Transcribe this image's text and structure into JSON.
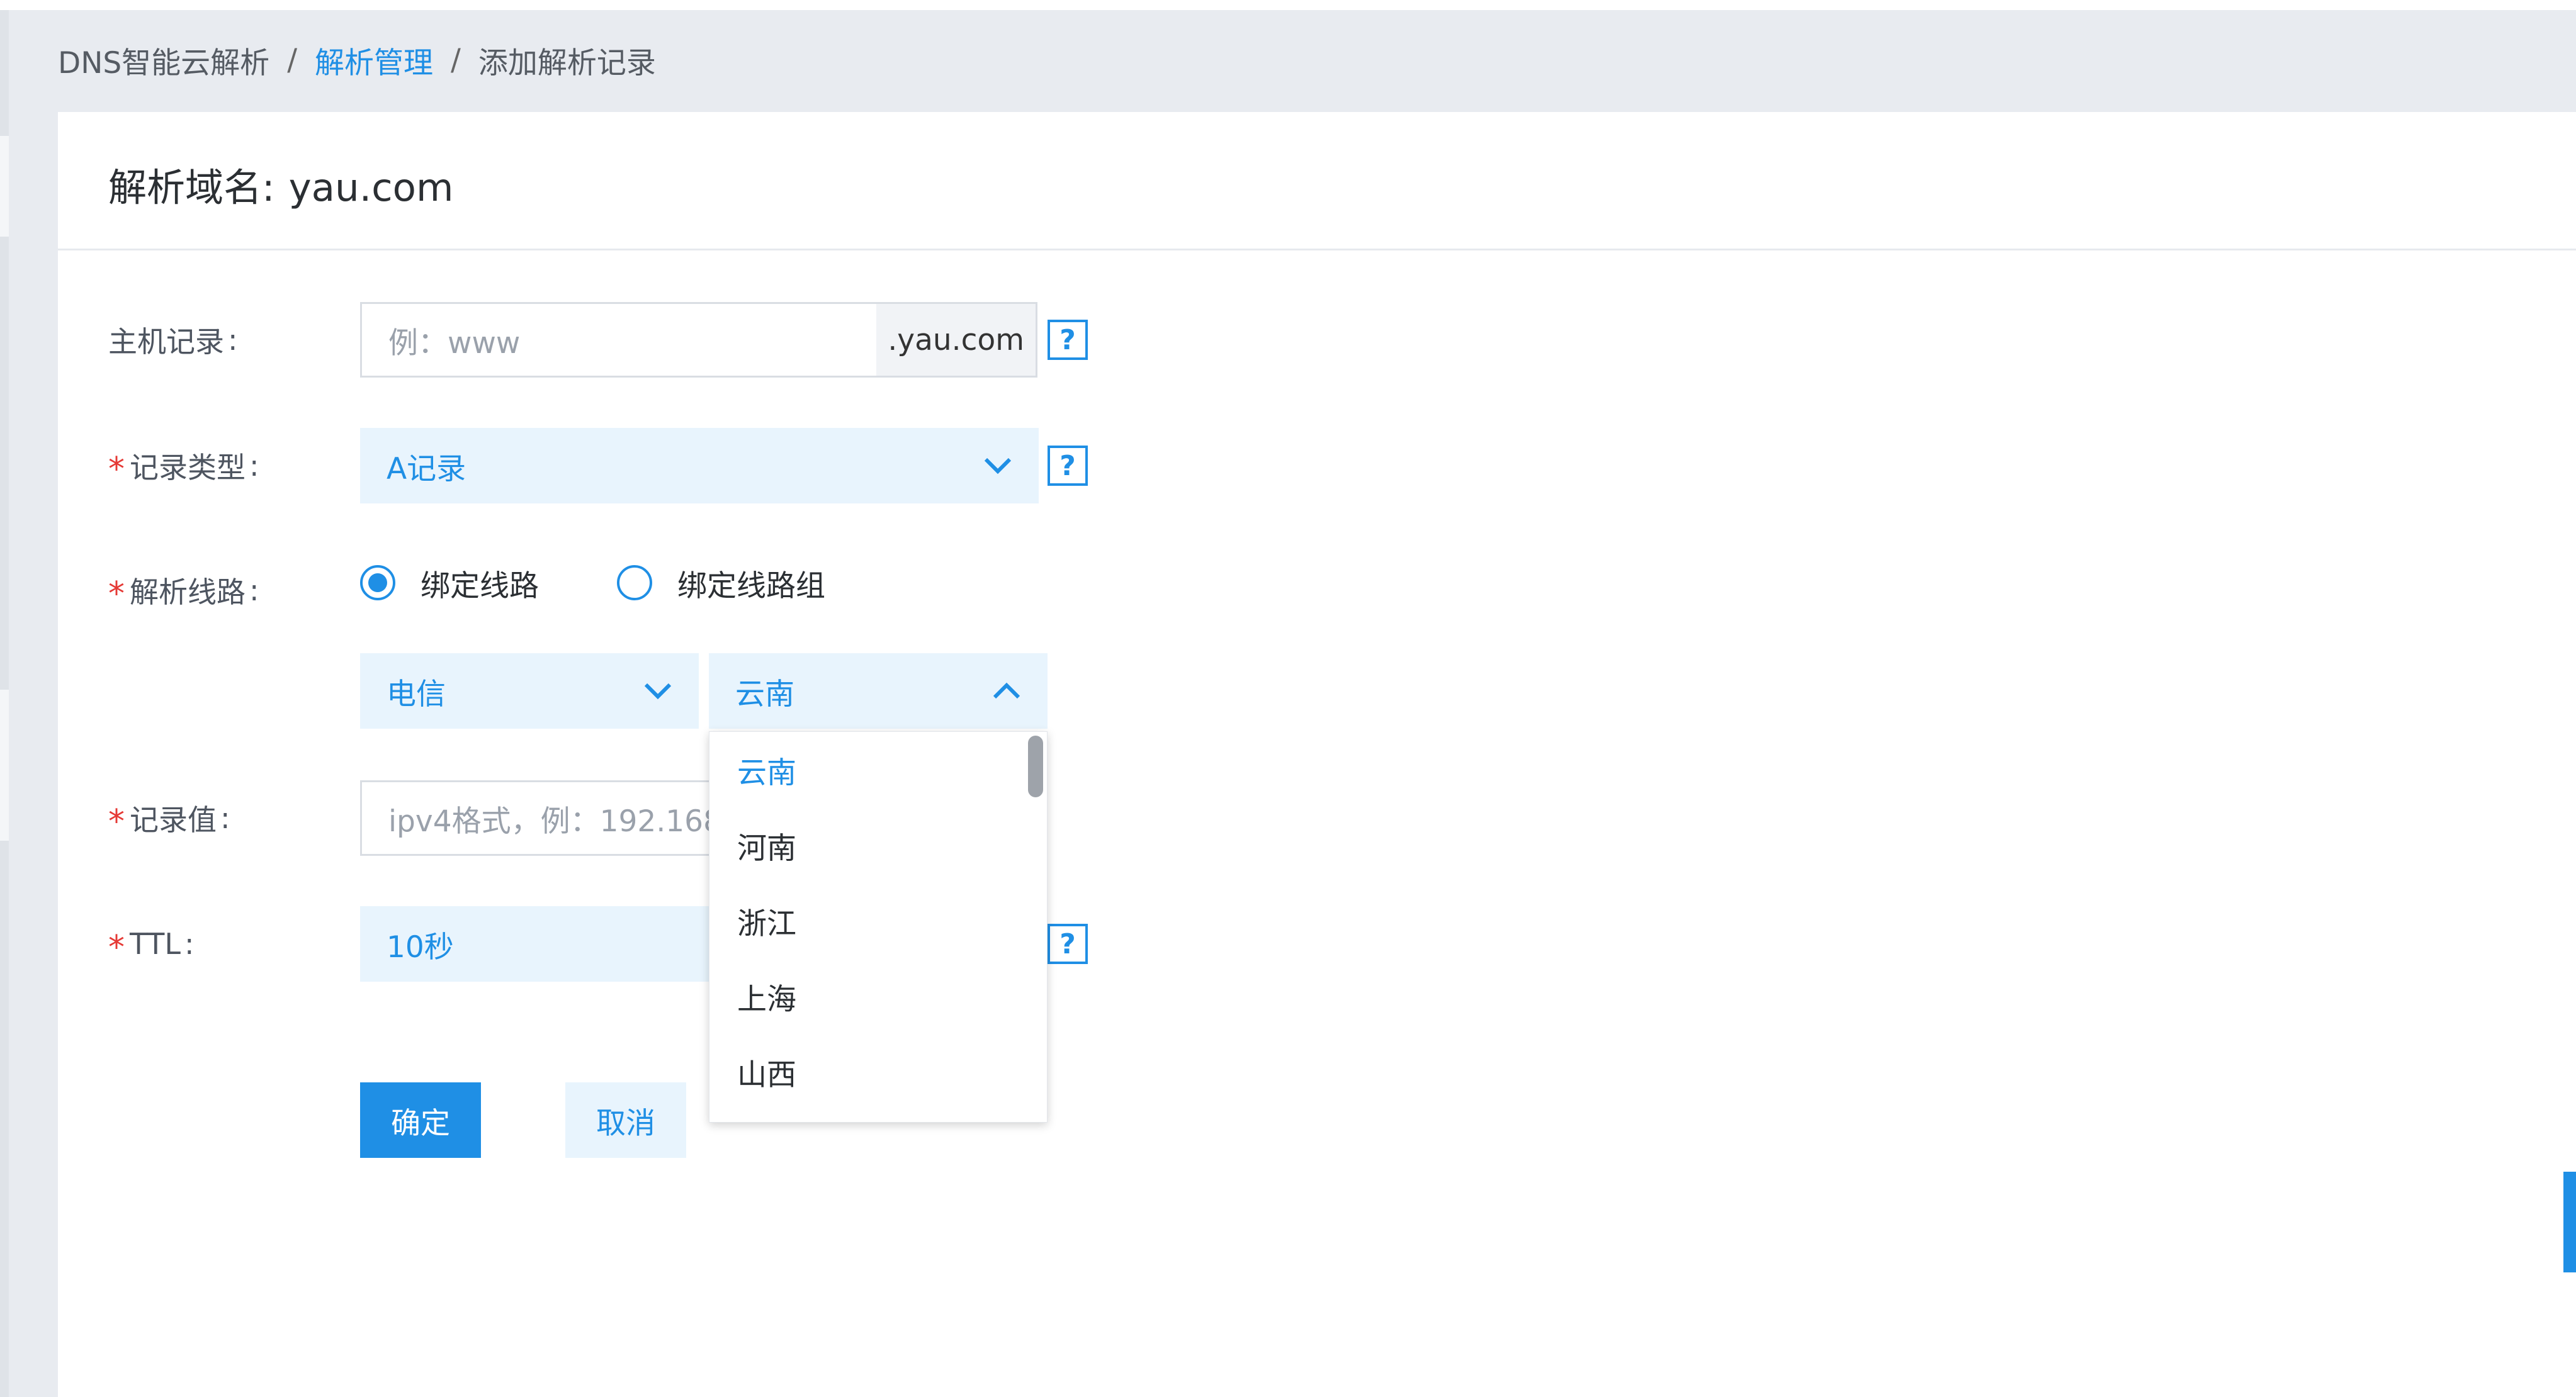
{
  "breadcrumb": {
    "root": "DNS智能云解析",
    "sep1": "/",
    "manage": "解析管理",
    "sep2": "/",
    "current": "添加解析记录"
  },
  "header": {
    "title_label": "解析域名:",
    "domain": "yau.com"
  },
  "form": {
    "host": {
      "label": "主机记录",
      "colon": ":",
      "placeholder": "例：www",
      "suffix": ".yau.com",
      "help": "?"
    },
    "record_type": {
      "required": "*",
      "label": "记录类型",
      "colon": ":",
      "value": "A记录",
      "help": "?"
    },
    "line": {
      "required": "*",
      "label": "解析线路",
      "colon": ":",
      "options": [
        "绑定线路",
        "绑定线路组"
      ],
      "selected_index": 0,
      "isp": "电信",
      "region": "云南",
      "region_dropdown": [
        "云南",
        "河南",
        "浙江",
        "上海",
        "山西"
      ]
    },
    "value": {
      "required": "*",
      "label": "记录值",
      "colon": ":",
      "placeholder": "ipv4格式，例：192.168"
    },
    "ttl": {
      "required": "*",
      "label": "TTL",
      "colon": ":",
      "value": "10秒",
      "help": "?"
    }
  },
  "actions": {
    "confirm": "确定",
    "cancel": "取消"
  },
  "colors": {
    "accent": "#1f8fe5",
    "required": "#e53935",
    "select_bg": "#e8f4fd",
    "page_bg": "#e8ebf0"
  },
  "icons": {
    "chevron_down": "chevron-down-icon",
    "chevron_up": "chevron-up-icon",
    "help": "question-mark-icon"
  }
}
